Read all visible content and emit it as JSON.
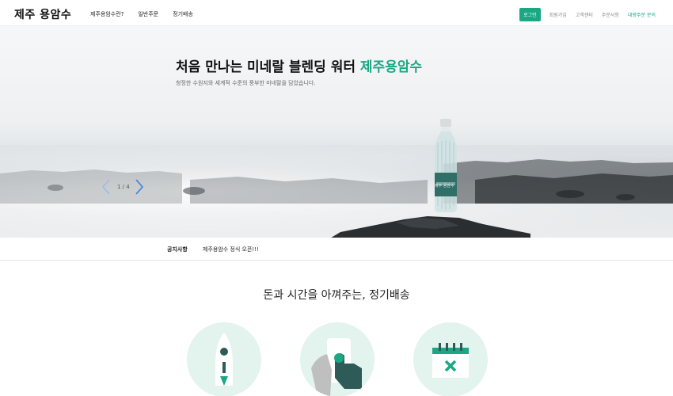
{
  "header": {
    "logo": "제주 용암수",
    "nav": [
      "제주용암수란?",
      "일반주문",
      "정기배송"
    ],
    "login": "로그인",
    "util_links": [
      "회원가입",
      "고객센터",
      "주문사항"
    ],
    "bulk_order": "대량주문 문의"
  },
  "hero": {
    "title_main": "처음 만나는 미네랄 블렌딩 워터 ",
    "title_accent": "제주용암수",
    "subtitle": "청정한 수원지와 세계적 수준의 풍부한 미네랄을 담았습니다.",
    "counter": "1 / 4",
    "bottle_label": "제주 용암수"
  },
  "notice": {
    "label": "공지사항",
    "text": "제주용암수 정식 오픈!!!"
  },
  "section": {
    "title": "돈과 시간을 아껴주는, 정기배송"
  },
  "colors": {
    "accent": "#1aa884",
    "dark_teal": "#2e5a57",
    "circle_bg": "#e3f3ee"
  },
  "icons": [
    "rocket-icon",
    "tap-phone-icon",
    "calendar-x-icon"
  ]
}
